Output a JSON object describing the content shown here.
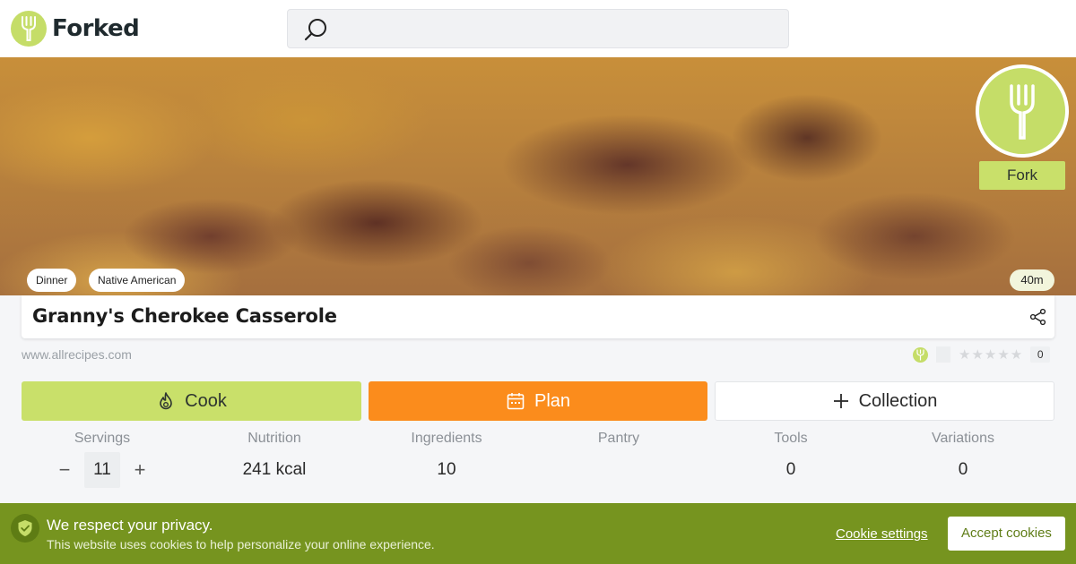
{
  "header": {
    "brand": "Forked",
    "search_placeholder": ""
  },
  "hero": {
    "fork_label": "Fork",
    "tags": [
      "Dinner",
      "Native American"
    ],
    "total_time": "40m"
  },
  "recipe": {
    "title": "Granny's Cherokee Casserole",
    "source": "www.allrecipes.com",
    "rating_count": "0",
    "stars": "★★★★★"
  },
  "actions": {
    "cook": "Cook",
    "plan": "Plan",
    "collection": "Collection"
  },
  "stats": {
    "servings_label": "Servings",
    "servings_value": "11",
    "nutrition_label": "Nutrition",
    "nutrition_value": "241 kcal",
    "ingredients_label": "Ingredients",
    "ingredients_value": "10",
    "pantry_label": "Pantry",
    "pantry_value": "",
    "tools_label": "Tools",
    "tools_value": "0",
    "variations_label": "Variations",
    "variations_value": "0",
    "minus": "−",
    "plus": "+"
  },
  "cookie": {
    "title": "We respect your privacy.",
    "text": "This website uses cookies to help personalize your online experience.",
    "settings": "Cookie settings",
    "accept": "Accept cookies"
  },
  "colors": {
    "brand_green": "#c5dd68",
    "plan_orange": "#fb8c1c",
    "cookie_bar": "#76941f"
  },
  "icons": [
    "fork-icon",
    "search-icon",
    "share-icon",
    "flame-icon",
    "calendar-icon",
    "plus-icon",
    "shield-check-icon"
  ]
}
